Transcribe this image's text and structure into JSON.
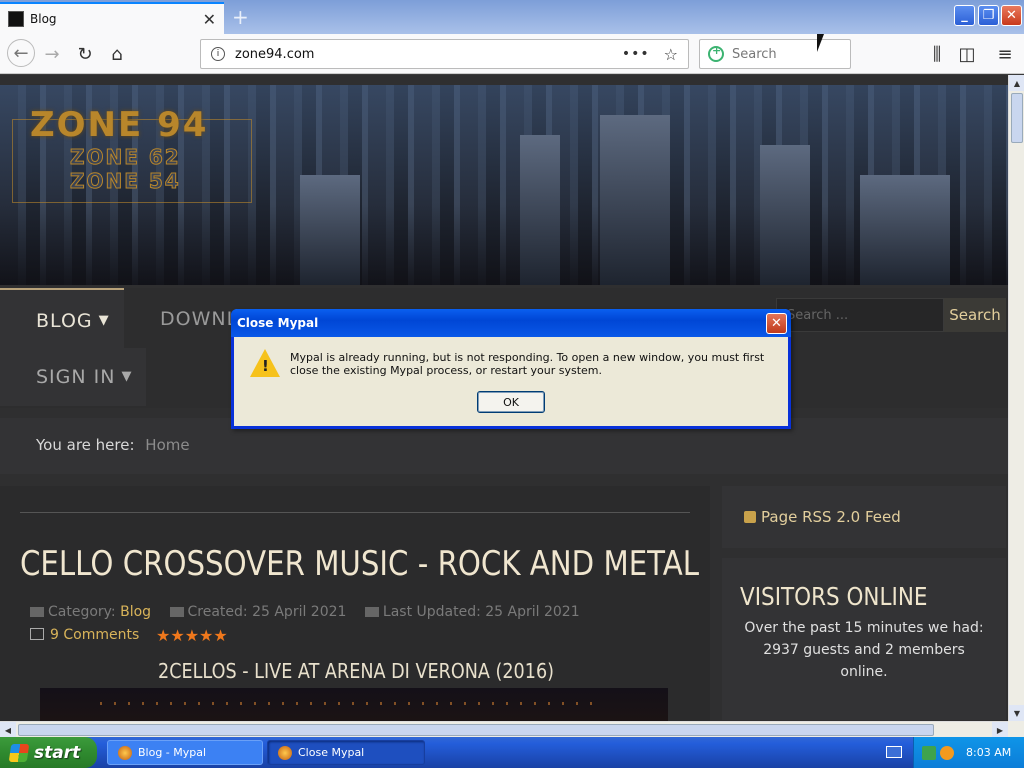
{
  "browser": {
    "tab_title": "Blog",
    "url": "zone94.com",
    "search_placeholder": "Search"
  },
  "site": {
    "logo_main": "ZONE 94",
    "logo_sub_1": "ZONE 62",
    "logo_sub_2": "ZONE 54",
    "nav": {
      "blog": "BLOG",
      "downloads": "DOWNL",
      "sign_in": "SIGN IN"
    },
    "search_placeholder": "Search ...",
    "search_button": "Search",
    "breadcrumb_label": "You are here:",
    "breadcrumb_home": "Home"
  },
  "article": {
    "title": "CELLO CROSSOVER MUSIC - ROCK AND METAL",
    "category_label": "Category:",
    "category_value": "Blog",
    "created": "Created: 25 April 2021",
    "updated": "Last Updated: 25 April 2021",
    "comments": "9 Comments",
    "stars": "★★★★★",
    "video_title": "2CELLOS - LIVE AT ARENA DI VERONA (2016)"
  },
  "sidebar": {
    "rss": "Page RSS 2.0 Feed",
    "visitors_title": "VISITORS ONLINE",
    "visitors_text": "Over the past 15 minutes we had: 2937 guests and 2 members online."
  },
  "dialog": {
    "title": "Close Mypal",
    "message": "Mypal is already running, but is not responding. To open a new window, you must first close the existing Mypal process, or restart your system.",
    "ok": "OK"
  },
  "taskbar": {
    "start": "start",
    "task1": "Blog - Mypal",
    "task2": "Close Mypal",
    "clock": "8:03 AM"
  },
  "colors": {
    "accent_gold": "#d9b45a",
    "xp_blue": "#0046d5",
    "star_orange": "#f0781c"
  }
}
